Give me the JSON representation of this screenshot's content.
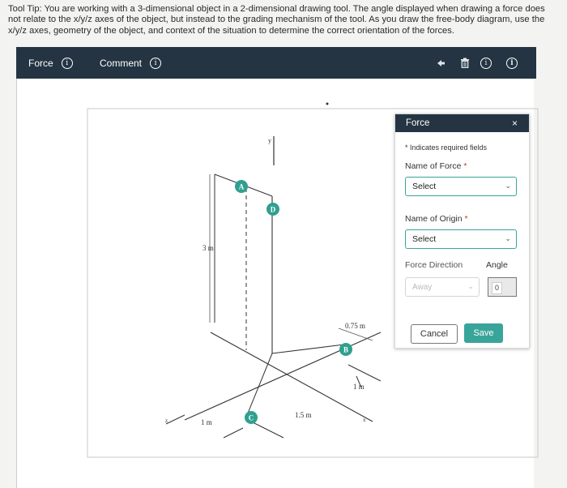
{
  "tooltip": {
    "text": "Tool Tip: You are working with a 3-dimensional object in a 2-dimensional drawing tool. The angle displayed when drawing a force does not relate to the x/y/z axes of the object, but instead to the grading mechanism of the tool. As you draw the free-body diagram, use the x/y/z axes, geometry of the object, and context of the situation to determine the correct orientation of the forces."
  },
  "toolbar": {
    "force_label": "Force",
    "comment_label": "Comment",
    "info_glyph": "i",
    "right_icons": [
      "undo-arrow-icon",
      "trash-icon",
      "info-icon",
      "help-icon"
    ]
  },
  "diagram": {
    "points": [
      "A",
      "D",
      "B",
      "C"
    ],
    "dimensions": [
      "3 m",
      "0.75 m",
      "1 m",
      "1 m",
      "1.5 m"
    ],
    "axes": [
      "y",
      "z",
      "x"
    ]
  },
  "panel": {
    "title": "Force",
    "close": "×",
    "required_note": "* Indicates required fields",
    "name_of_force_label": "Name of Force",
    "name_of_force_value": "Select",
    "name_of_origin_label": "Name of Origin",
    "name_of_origin_value": "Select",
    "required_star": "*",
    "force_direction_label": "Force Direction",
    "angle_label": "Angle",
    "direction_value": "Away",
    "angle_value": "0",
    "cancel_label": "Cancel",
    "save_label": "Save"
  },
  "colors": {
    "toolbar_bg": "#243442",
    "accent": "#39a59a",
    "marker": "#2fa08f"
  }
}
